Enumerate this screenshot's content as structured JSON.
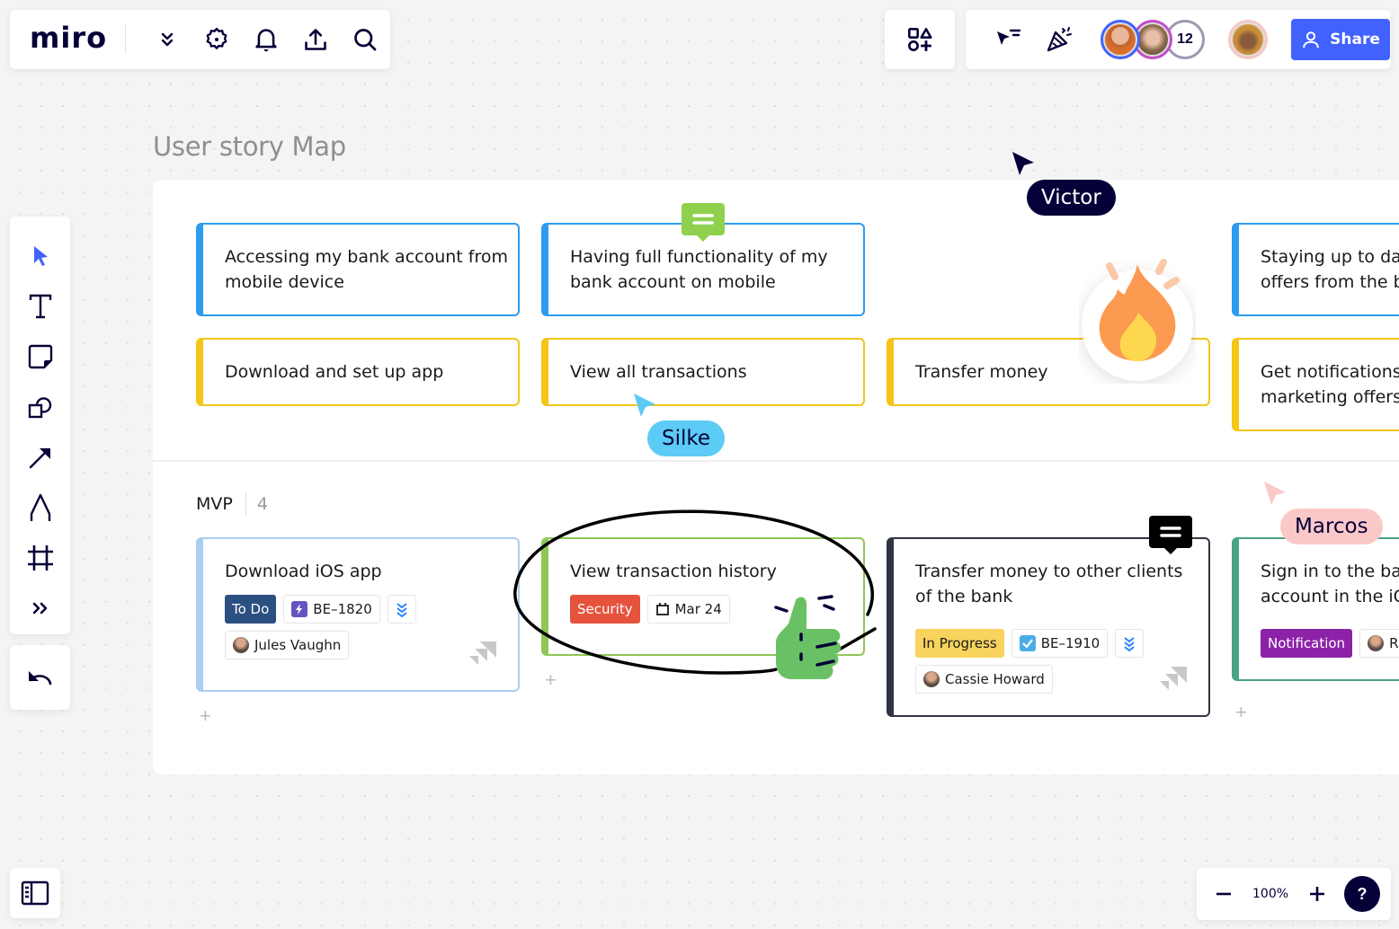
{
  "app": {
    "logo": "miro"
  },
  "top_left_toolbar": {
    "icons": [
      "more-chevrons-icon",
      "settings-icon",
      "notifications-bell-icon",
      "export-upload-icon",
      "search-icon"
    ]
  },
  "top_right_toolbar": {
    "apps_icon": "apps-shapes-icon",
    "icons": [
      "cursor-filter-icon",
      "celebrate-party-icon"
    ],
    "collaborators": [
      {
        "ring_color": "#4262ff"
      },
      {
        "ring_color": "#c24ec8"
      }
    ],
    "extra_count": "12",
    "current_user_ring": "#f7c6c6",
    "share_label": "Share"
  },
  "left_toolbar": {
    "tools": [
      "select-icon",
      "text-icon",
      "sticky-note-icon",
      "shapes-icon",
      "arrow-line-icon",
      "pen-icon",
      "frame-icon",
      "more-tools-icon"
    ],
    "undo_icon": "undo-icon"
  },
  "bottom": {
    "zoom_level": "100%",
    "help_label": "?",
    "pages_icon": "pages-panel-icon"
  },
  "board": {
    "title": "User story Map",
    "activities": [
      {
        "text": "Accessing my bank account from mobile device",
        "color": "#2d9bf0"
      },
      {
        "text": "Having full functionality of my bank account on mobile",
        "color": "#2d9bf0"
      },
      {
        "text": "Staying up to date with offers from the bank",
        "color": "#2d9bf0"
      }
    ],
    "steps": [
      {
        "text": "Download and set up app",
        "color": "#f5c518"
      },
      {
        "text": "View all transactions",
        "color": "#f5c518"
      },
      {
        "text": "Transfer money",
        "color": "#f5c518"
      },
      {
        "text": "Get notifications about marketing offers",
        "color": "#f5c518"
      }
    ],
    "release": {
      "label": "MVP",
      "count": "4"
    },
    "stories": [
      {
        "title": "Download iOS app",
        "status": "To Do",
        "status_color": "#2b4f81",
        "issue_key": "BE–1820",
        "issue_type": "epic",
        "assignee": "Jules Vaughn",
        "border_color": "#a9cdf3"
      },
      {
        "title": "View transaction history",
        "label": "Security",
        "label_color": "#e5533d",
        "due_date": "Mar 24",
        "border_color": "#8fc657"
      },
      {
        "title": "Transfer money to other clients of the bank",
        "status": "In Progress",
        "status_color": "#f8d35e",
        "issue_key": "BE–1910",
        "issue_type": "task",
        "assignee": "Cassie Howard",
        "border_color": "#2f3542"
      },
      {
        "title": "Sign in to the bank account in the iOS app",
        "label": "Notification",
        "label_color": "#8c22a8",
        "assignee_initial": "R",
        "border_color": "#4aa382"
      }
    ]
  },
  "cursors": [
    {
      "name": "Victor",
      "color": "#050038",
      "text_color": "#ffffff"
    },
    {
      "name": "Silke",
      "color": "#5ccbf5",
      "text_color": "#050038"
    },
    {
      "name": "Marcos",
      "color": "#fbc8c8",
      "text_color": "#050038"
    }
  ],
  "comments": [
    {
      "color": "#8fd14f"
    },
    {
      "color": "#000000"
    }
  ],
  "reactions": [
    "fire-sticker",
    "thumbs-up-sticker"
  ]
}
